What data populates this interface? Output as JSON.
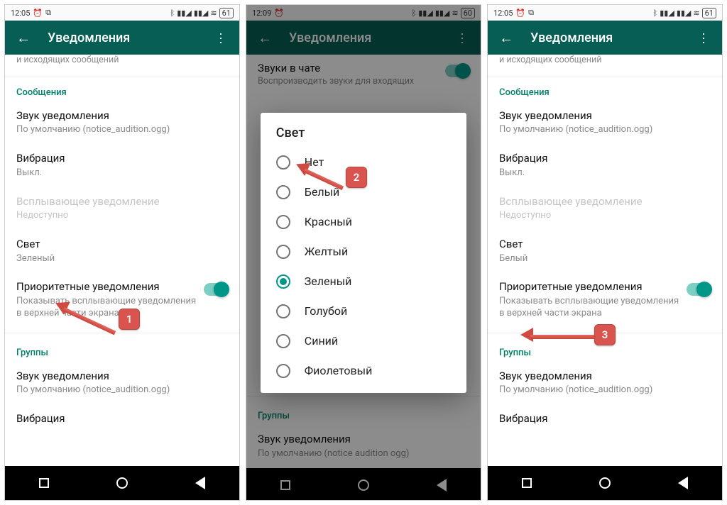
{
  "status": {
    "time_a": "12:05",
    "time_b": "12:09",
    "battery_a": "61",
    "battery_b": "60"
  },
  "appbar": {
    "title": "Уведомления"
  },
  "truncated_subtitle_line1_hidden": "Воспроизводить звуки для входящих",
  "truncated_subtitle_line2": "и исходящих сообщений",
  "chat_sounds": {
    "title": "Звуки в чате",
    "subtitle": "Воспроизводить звуки для входящих"
  },
  "section_messages": "Сообщения",
  "section_groups": "Группы",
  "items": {
    "sound": {
      "title": "Звук уведомления",
      "value": "По умолчанию (notice_audition.ogg)"
    },
    "vibration": {
      "title": "Вибрация",
      "value": "Выкл."
    },
    "popup": {
      "title": "Всплывающее уведомление",
      "value": "Недоступно"
    },
    "light": {
      "title": "Свет",
      "value_a": "Зеленый",
      "value_c": "Белый"
    },
    "priority": {
      "title": "Приоритетные уведомления",
      "subtitle": "Показывать всплывающие уведомления в верхней части экрана"
    },
    "group_sound": {
      "title": "Звук уведомления",
      "value": "По умолчанию (notice_audition.ogg)"
    },
    "group_vibration_title": "Вибрация",
    "group_sound_value_truncated": "По умолчанию (notice audition ogg)"
  },
  "dialog": {
    "title": "Свет",
    "options": [
      "Нет",
      "Белый",
      "Красный",
      "Желтый",
      "Зеленый",
      "Голубой",
      "Синий",
      "Фиолетовый"
    ],
    "selected_index": 4
  },
  "callouts": {
    "c1": "1",
    "c2": "2",
    "c3": "3"
  }
}
